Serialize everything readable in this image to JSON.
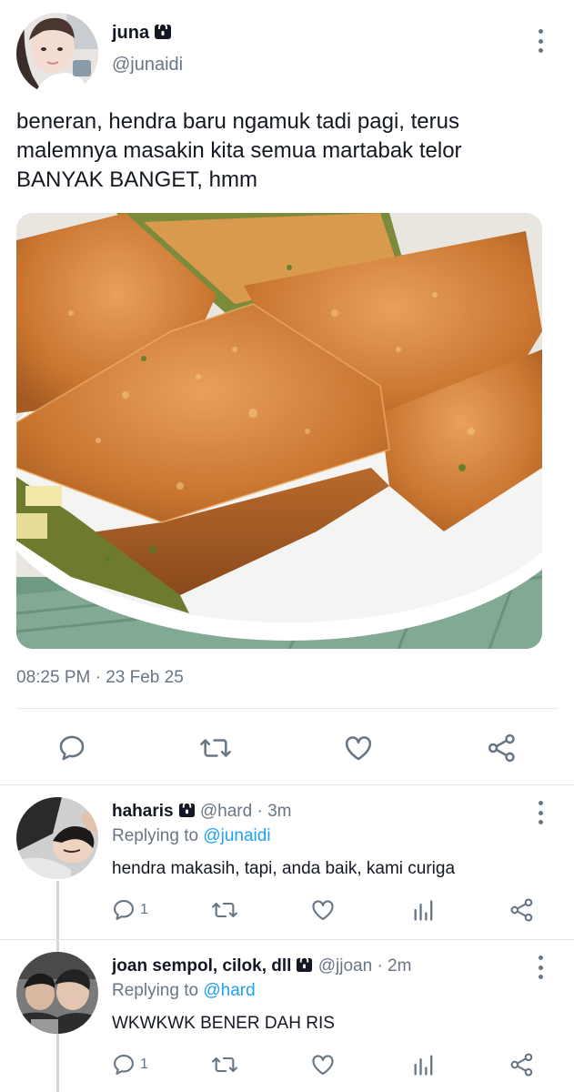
{
  "tweet": {
    "author_name": "juna",
    "author_handle": "@junaidi",
    "text": "beneran, hendra baru ngamuk tadi pagi, terus malemnya masakin kita semua martabak telor BANYAK BANGET, hmm",
    "timestamp": "08:25 PM · 23 Feb 25"
  },
  "replies": [
    {
      "name": "haharis",
      "handle": "@hard",
      "time": "· 3m",
      "replying_label": "Replying to",
      "replying_to": "@junaidi",
      "text": "hendra makasih, tapi, anda baik, kami curiga",
      "reply_count": "1"
    },
    {
      "name": "joan sempol, cilok, dll",
      "handle": "@jjoan",
      "time": "· 2m",
      "replying_label": "Replying to",
      "replying_to": "@hard",
      "text": "WKWKWK BENER DAH RIS",
      "reply_count": "1"
    }
  ],
  "colors": {
    "text": "#141823",
    "secondary": "#687684",
    "link": "#1da1f2",
    "divider": "#e1e8ed"
  },
  "icons": [
    "lock-icon",
    "more-icon",
    "reply-icon",
    "retweet-icon",
    "like-icon",
    "share-icon",
    "analytics-icon"
  ]
}
